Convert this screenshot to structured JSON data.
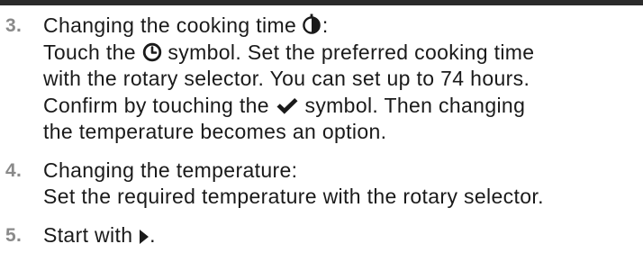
{
  "steps": [
    {
      "number": "3.",
      "title": "Changing the cooking time",
      "title_after": ":",
      "line2_before": "Touch the",
      "line2_after": "symbol. Set the preferred cooking time",
      "line3": "with the rotary selector. You can set up to 74 hours.",
      "line4_before": "Confirm by touching the",
      "line4_after": "symbol. Then changing",
      "line5": "the temperature becomes an option."
    },
    {
      "number": "4.",
      "title": "Changing the temperature:",
      "line2": "Set the required temperature with the rotary selector."
    },
    {
      "number": "5.",
      "text_before": "Start with",
      "text_after": "."
    }
  ],
  "icons": {
    "cooking_time": "cooking-time-icon",
    "clock": "clock-icon",
    "checkmark": "checkmark-icon",
    "start": "play-icon"
  },
  "colors": {
    "text": "#1a1a1a",
    "step_number": "#8a8a8a",
    "top_bar": "#2b2b2b"
  }
}
